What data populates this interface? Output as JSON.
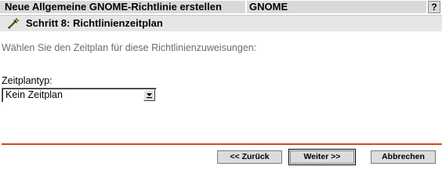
{
  "header": {
    "title": "Neue Allgemeine GNOME-Richtlinie erstellen",
    "platform": "GNOME",
    "help_label": "?"
  },
  "step": {
    "icon": "wizard-wand-icon",
    "title": "Schritt 8: Richtlinienzeitplan"
  },
  "form": {
    "instruction": "Wählen Sie den Zeitplan für diese Richtlinienzuweisungen:",
    "schedule_type_label": "Zeitplantyp:",
    "schedule_type_value": "Kein Zeitplan"
  },
  "buttons": {
    "back": "<< Zurück",
    "next": "Weiter >>",
    "cancel": "Abbrechen"
  },
  "colors": {
    "divider": "#d2491b",
    "header_bg": "#d9d9d9"
  }
}
